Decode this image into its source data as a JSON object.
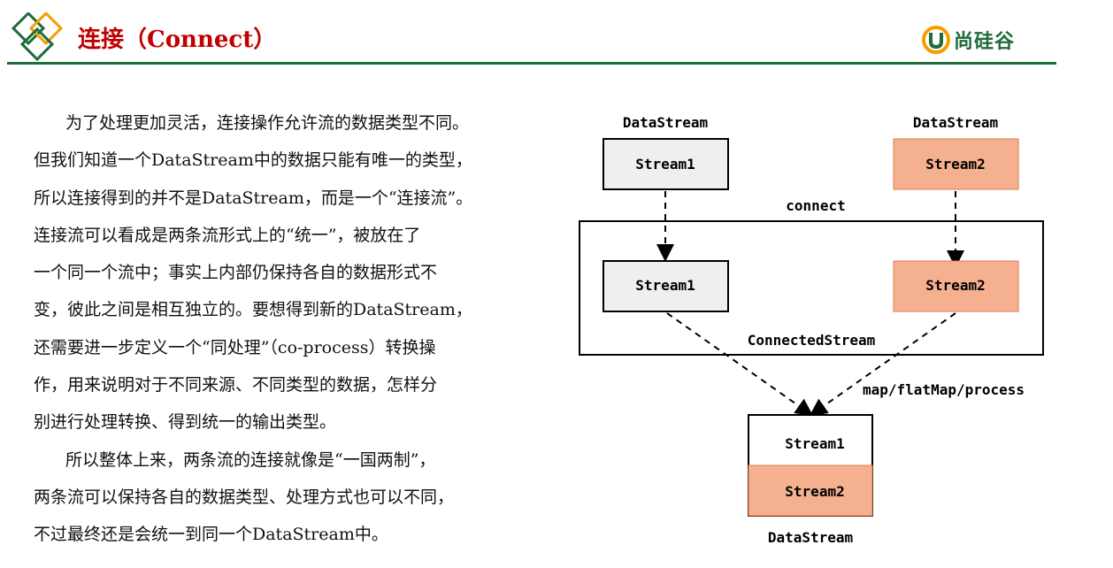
{
  "header": {
    "title": "连接（Connect）",
    "brand": "尚硅谷",
    "accent_color": "#1f6b3a",
    "title_color": "#c00000",
    "logo_icon": "double-diamond-icon",
    "brand_icon": "u-shield-icon"
  },
  "body_text": {
    "lines": [
      "为了处理更加灵活，连接操作允许流的数据类型不同。",
      "但我们知道一个DataStream中的数据只能有唯一的类型，",
      "所以连接得到的并不是DataStream，而是一个“连接流”。",
      "连接流可以看成是两条流形式上的“统一”，被放在了",
      "一个同一个流中；事实上内部仍保持各自的数据形式不",
      "变，彼此之间是相互独立的。要想得到新的DataStream，",
      "还需要进一步定义一个“同处理”（co-process）转换操",
      "作，用来说明对于不同来源、不同类型的数据，怎样分",
      "别进行处理转换、得到统一的输出类型。",
      "所以整体上来，两条流的连接就像是“一国两制”，",
      "两条流可以保持各自的数据类型、处理方式也可以不同，",
      "不过最终还是会统一到同一个DataStream中。"
    ]
  },
  "diagram": {
    "source_left_label": "DataStream",
    "source_right_label": "DataStream",
    "stream1_label": "Stream1",
    "stream2_label": "Stream2",
    "connect_label": "connect",
    "connected_stream_label": "ConnectedStream",
    "transform_label": "map/flatMap/process",
    "output_label": "DataStream",
    "stream1_fill": "#efefef",
    "stream2_fill": "#f5b18f"
  }
}
